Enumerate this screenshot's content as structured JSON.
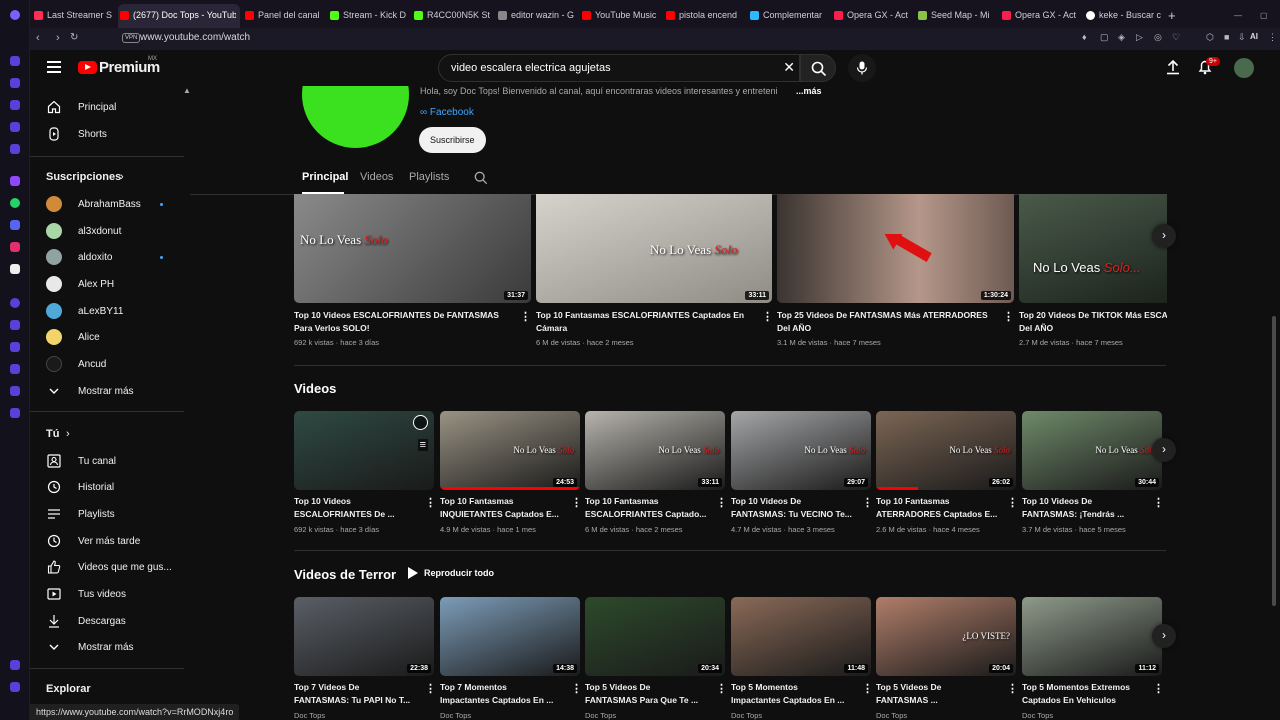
{
  "browser": {
    "tabs": [
      {
        "label": "Last Streamer S",
        "color": "#ff2d55"
      },
      {
        "label": "(2677) Doc Tops - YouTub",
        "color": "#ff0000",
        "active": true
      },
      {
        "label": "Panel del canal",
        "color": "#ff0000"
      },
      {
        "label": "Stream - Kick D",
        "color": "#53fc18"
      },
      {
        "label": "R4CC00N5K St",
        "color": "#53fc18"
      },
      {
        "label": "editor wazin - G",
        "color": "#888888"
      },
      {
        "label": "YouTube Music",
        "color": "#ff0000"
      },
      {
        "label": "pistola encend",
        "color": "#ff0000"
      },
      {
        "label": "Complementar",
        "color": "#2eb8ff"
      },
      {
        "label": "Opera GX - Act",
        "color": "#fa1e4e"
      },
      {
        "label": "Seed Map - Mi",
        "color": "#8bc34a"
      },
      {
        "label": "Opera GX - Act",
        "color": "#fa1e4e"
      },
      {
        "label": "keke - Buscar c",
        "color": "#ffffff"
      }
    ],
    "url": "www.youtube.com/watch",
    "vpn_label": "VPN",
    "ai_label": "AI",
    "status_url": "https://www.youtube.com/watch?v=RrMODNxj4ro"
  },
  "header": {
    "brand": "Premium",
    "region": "MX",
    "search_value": "video escalera electrica agujetas",
    "notification_count": "9+"
  },
  "sidebar": {
    "main": [
      {
        "label": "Principal",
        "icon": "home-icon"
      },
      {
        "label": "Shorts",
        "icon": "shorts-icon"
      }
    ],
    "subscriptions_title": "Suscripciones",
    "subscriptions": [
      {
        "label": "AbrahamBass",
        "color": "#d08a3a",
        "dot": true
      },
      {
        "label": "al3xdonut",
        "color": "#a9d7a5",
        "dot": false
      },
      {
        "label": "aldoxito",
        "color": "#8fa3a0",
        "dot": true
      },
      {
        "label": "Alex PH",
        "color": "#e8e8e8",
        "dot": false
      },
      {
        "label": "aLexBY11",
        "color": "#4fa8d8",
        "dot": false
      },
      {
        "label": "Alice",
        "color": "#f2d56a",
        "dot": false
      },
      {
        "label": "Ancud",
        "color": "#1a1a1a",
        "dot": false
      }
    ],
    "show_more_1": "Mostrar más",
    "you_title": "Tú",
    "you_items": [
      {
        "label": "Tu canal",
        "icon": "channel-icon"
      },
      {
        "label": "Historial",
        "icon": "history-icon"
      },
      {
        "label": "Playlists",
        "icon": "playlists-icon"
      },
      {
        "label": "Ver más tarde",
        "icon": "watch-later-icon"
      },
      {
        "label": "Videos que me gus...",
        "icon": "like-icon"
      },
      {
        "label": "Tus videos",
        "icon": "your-videos-icon"
      },
      {
        "label": "Descargas",
        "icon": "download-icon"
      }
    ],
    "show_more_2": "Mostrar más",
    "explore_title": "Explorar"
  },
  "channel": {
    "description": "Hola, soy Doc Tops! Bienvenido al canal, aquí encontraras videos interesantes y entreteni",
    "more": "...más",
    "link": "Facebook",
    "subscribe": "Suscribirse",
    "tabs": [
      "Principal",
      "Videos",
      "Playlists"
    ]
  },
  "row1": [
    {
      "title_1": "Top 10 Videos ESCALOFRIANTES De FANTASMAS",
      "title_2": "Para Verlos SOLO!",
      "meta": "692 k vistas · hace 3 días",
      "duration": "31:37",
      "overlay": "No Lo Veas",
      "overlay_red": "Solo",
      "bg": "#6c6c6c"
    },
    {
      "title_1": "Top 10 Fantasmas ESCALOFRIANTES Captados En",
      "title_2": "Cámara",
      "meta": "6 M de vistas · hace 2 meses",
      "duration": "33:11",
      "overlay": "No Lo Veas",
      "overlay_red": "Solo",
      "bg": "#b7b4ad"
    },
    {
      "title_1": "Top 25 Videos De FANTASMAS Más ATERRADORES",
      "title_2": "Del AÑO",
      "meta": "3.1 M de vistas · hace 7 meses",
      "duration": "1:30:24",
      "overlay": "",
      "overlay_red": "",
      "bg": "#6e5a52"
    },
    {
      "title_1": "Top 20 Videos De TIKTOK Más ESCA",
      "title_2": "Del AÑO",
      "meta": "2.7 M de vistas · hace 7 meses",
      "duration": "",
      "overlay": "No Lo Veas",
      "overlay_red": "Solo...",
      "bg": "#2c3b2f"
    }
  ],
  "videos_section": {
    "title": "Videos",
    "items": [
      {
        "title_1": "Top 10 Videos",
        "title_2": "ESCALOFRIANTES De ...",
        "meta": "692 k vistas · hace 3 días",
        "duration": "",
        "overlay": "",
        "overlay_red": "",
        "bg": "#2f4a43",
        "progress": 0
      },
      {
        "title_1": "Top 10 Fantasmas",
        "title_2": "INQUIETANTES Captados E...",
        "meta": "4.9 M de vistas · hace 1 mes",
        "duration": "24:53",
        "overlay": "No Lo Veas",
        "overlay_red": "Solo",
        "bg": "#9a9384",
        "progress": 1.0
      },
      {
        "title_1": "Top 10 Fantasmas",
        "title_2": "ESCALOFRIANTES Captado...",
        "meta": "6 M de vistas · hace 2 meses",
        "duration": "33:11",
        "overlay": "No Lo Veas",
        "overlay_red": "Solo",
        "bg": "#b7b4ad",
        "progress": 0
      },
      {
        "title_1": "Top 10 Videos De",
        "title_2": "FANTASMAS: Tu VECINO Te...",
        "meta": "4.7 M de vistas · hace 3 meses",
        "duration": "29:07",
        "overlay": "No Lo Veas",
        "overlay_red": "Solo",
        "bg": "#a5a6a8",
        "progress": 0
      },
      {
        "title_1": "Top 10 Fantasmas",
        "title_2": "ATERRADORES Captados E...",
        "meta": "2.6 M de vistas · hace 4 meses",
        "duration": "26:02",
        "overlay": "No Lo Veas",
        "overlay_red": "Solo",
        "bg": "#7c6655",
        "progress": 0.3
      },
      {
        "title_1": "Top 10 Videos De",
        "title_2": "FANTASMAS: ¡Tendrás ...",
        "meta": "3.7 M de vistas · hace 5 meses",
        "duration": "30:44",
        "overlay": "No Lo Veas",
        "overlay_red": "Solo",
        "bg": "#6f8a6a",
        "progress": 0
      }
    ]
  },
  "terror_section": {
    "title": "Videos de Terror",
    "play_all": "Reproducir todo",
    "items": [
      {
        "title_1": "Top 7 Videos De",
        "title_2": "FANTASMAS: Tu PAPI No T...",
        "channel": "Doc Tops",
        "duration": "22:38",
        "overlay": "",
        "bg": "#5a5f66"
      },
      {
        "title_1": "Top 7 Momentos",
        "title_2": "Impactantes Captados En ...",
        "channel": "Doc Tops",
        "duration": "14:38",
        "overlay": "",
        "bg": "#7c9cb8"
      },
      {
        "title_1": "Top 5 Videos De",
        "title_2": "FANTASMAS Para Que Te ...",
        "channel": "Doc Tops",
        "duration": "20:34",
        "overlay": "",
        "bg": "#2d4a2b"
      },
      {
        "title_1": "Top 5 Momentos",
        "title_2": "Impactantes Captados En ...",
        "channel": "Doc Tops",
        "duration": "11:48",
        "overlay": "",
        "bg": "#8a6a58"
      },
      {
        "title_1": "Top 5 Videos De",
        "title_2": "FANTASMAS ...",
        "channel": "Doc Tops",
        "duration": "20:04",
        "overlay": "¿LO VISTE?",
        "bg": "#b07e6a"
      },
      {
        "title_1": "Top 5 Momentos Extremos",
        "title_2": "Captados En Vehiculos",
        "channel": "Doc Tops",
        "duration": "11:12",
        "overlay": "",
        "bg": "#8e9a8a"
      }
    ]
  }
}
